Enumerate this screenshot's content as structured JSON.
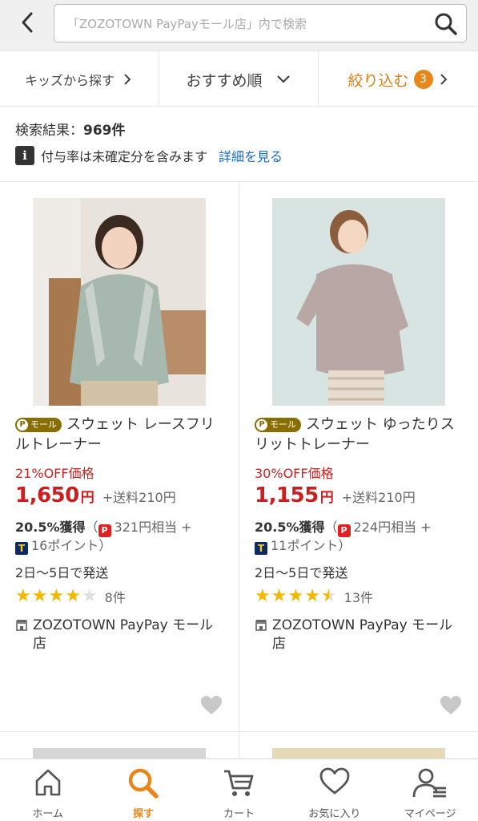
{
  "search": {
    "placeholder": "「ZOZOTOWN PayPayモール店」内で検索"
  },
  "sortbar": {
    "kids_label": "キッズから探す",
    "order_label": "おすすめ順",
    "filter_label": "絞り込む",
    "filter_count": "3"
  },
  "results": {
    "prefix": "検索結果：",
    "count": "969件"
  },
  "notice": {
    "text": "付与率は未確定分を含みます",
    "link": "詳細を見る"
  },
  "products": [
    {
      "mall_tag": "モール",
      "title": "スウェット レースフリルトレーナー",
      "discount": "21%OFF価格",
      "price": "1,650",
      "yen": "円",
      "shipping": "+送料210円",
      "rate": "20.5%獲得",
      "paypay": "321円相当 +",
      "tpoint": "16ポイント）",
      "ship_days": "2日〜5日で発送",
      "rating": 4,
      "reviews": "8件",
      "store": "ZOZOTOWN PayPay モール店"
    },
    {
      "mall_tag": "モール",
      "title": "スウェット ゆったりスリットトレーナー",
      "discount": "30%OFF価格",
      "price": "1,155",
      "yen": "円",
      "shipping": "+送料210円",
      "rate": "20.5%獲得",
      "paypay": "224円相当 +",
      "tpoint": "11ポイント）",
      "ship_days": "2日〜5日で発送",
      "rating": 4.5,
      "reviews": "13件",
      "store": "ZOZOTOWN PayPay モール店"
    }
  ],
  "tabs": [
    {
      "label": "ホーム",
      "icon": "home-icon"
    },
    {
      "label": "探す",
      "icon": "search-icon"
    },
    {
      "label": "カート",
      "icon": "cart-icon"
    },
    {
      "label": "お気に入り",
      "icon": "heart-icon"
    },
    {
      "label": "マイページ",
      "icon": "user-icon"
    }
  ],
  "colors": {
    "accent": "#e8861a",
    "price": "#cc1e1e",
    "link": "#1a6bc4",
    "star": "#f5b800"
  }
}
